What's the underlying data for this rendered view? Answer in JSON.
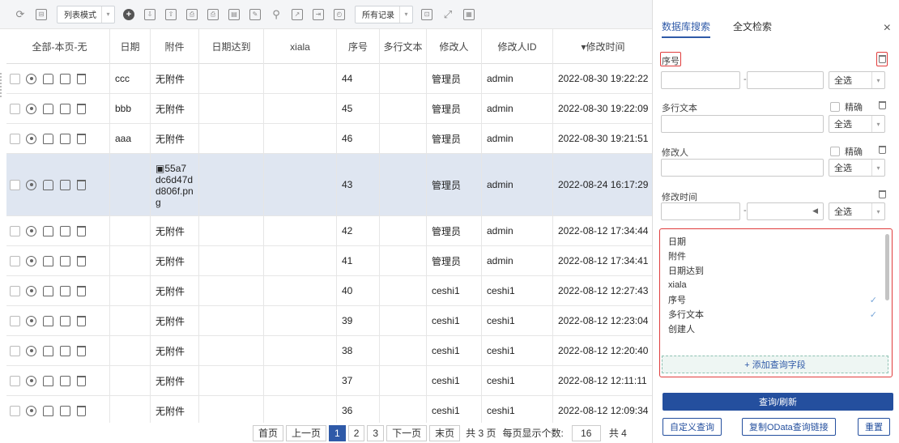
{
  "toolbar": {
    "view_mode": "列表模式",
    "record_filter": "所有记录"
  },
  "table": {
    "headers": [
      "全部-本页-无",
      "日期",
      "附件",
      "日期达到",
      "xiala",
      "序号",
      "多行文本",
      "修改人",
      "修改人ID",
      "▾修改时间"
    ],
    "rows": [
      {
        "date": "ccc",
        "attach": "无附件",
        "seq": "44",
        "modifier": "管理员",
        "modifier_id": "admin",
        "time": "2022-08-30 19:22:22"
      },
      {
        "date": "bbb",
        "attach": "无附件",
        "seq": "45",
        "modifier": "管理员",
        "modifier_id": "admin",
        "time": "2022-08-30 19:22:09"
      },
      {
        "date": "aaa",
        "attach": "无附件",
        "seq": "46",
        "modifier": "管理员",
        "modifier_id": "admin",
        "time": "2022-08-30 19:21:51"
      },
      {
        "date": "",
        "attach": "55a7 dc6d47d d806f.pn g",
        "seq": "43",
        "modifier": "管理员",
        "modifier_id": "admin",
        "time": "2022-08-24 16:17:29"
      },
      {
        "date": "",
        "attach": "无附件",
        "seq": "42",
        "modifier": "管理员",
        "modifier_id": "admin",
        "time": "2022-08-12 17:34:44"
      },
      {
        "date": "",
        "attach": "无附件",
        "seq": "41",
        "modifier": "管理员",
        "modifier_id": "admin",
        "time": "2022-08-12 17:34:41"
      },
      {
        "date": "",
        "attach": "无附件",
        "seq": "40",
        "modifier": "ceshi1",
        "modifier_id": "ceshi1",
        "time": "2022-08-12 12:27:43"
      },
      {
        "date": "",
        "attach": "无附件",
        "seq": "39",
        "modifier": "ceshi1",
        "modifier_id": "ceshi1",
        "time": "2022-08-12 12:23:04"
      },
      {
        "date": "",
        "attach": "无附件",
        "seq": "38",
        "modifier": "ceshi1",
        "modifier_id": "ceshi1",
        "time": "2022-08-12 12:20:40"
      },
      {
        "date": "",
        "attach": "无附件",
        "seq": "37",
        "modifier": "ceshi1",
        "modifier_id": "ceshi1",
        "time": "2022-08-12 12:11:11"
      },
      {
        "date": "",
        "attach": "无附件",
        "seq": "36",
        "modifier": "ceshi1",
        "modifier_id": "ceshi1",
        "time": "2022-08-12 12:09:34"
      }
    ]
  },
  "pager": {
    "first": "首页",
    "prev": "上一页",
    "pages": [
      "1",
      "2",
      "3"
    ],
    "next": "下一页",
    "last": "末页",
    "total_pages": "共 3 页",
    "page_size_label": "每页显示个数:",
    "page_size": "16",
    "total_prefix": "共 4"
  },
  "search_panel": {
    "tab_db": "数据库搜索",
    "tab_fulltext": "全文检索",
    "close": "×",
    "fields": {
      "seq_label": "序号",
      "seq_select": "全选",
      "text_label": "多行文本",
      "text_exact": "精确",
      "text_select": "全选",
      "modifier_label": "修改人",
      "modifier_exact": "精确",
      "modifier_select": "全选",
      "time_label": "修改时间",
      "time_select": "全选"
    },
    "field_list": [
      "日期",
      "附件",
      "日期达到",
      "xiala",
      "序号",
      "多行文本",
      "创建人"
    ],
    "field_list_checked": [
      "序号",
      "多行文本"
    ],
    "add_field": "+ 添加查询字段",
    "query_btn": "查询/刷新",
    "custom_btn": "自定义查询",
    "odata_btn": "复制OData查询链接",
    "reset_btn": "重置"
  }
}
